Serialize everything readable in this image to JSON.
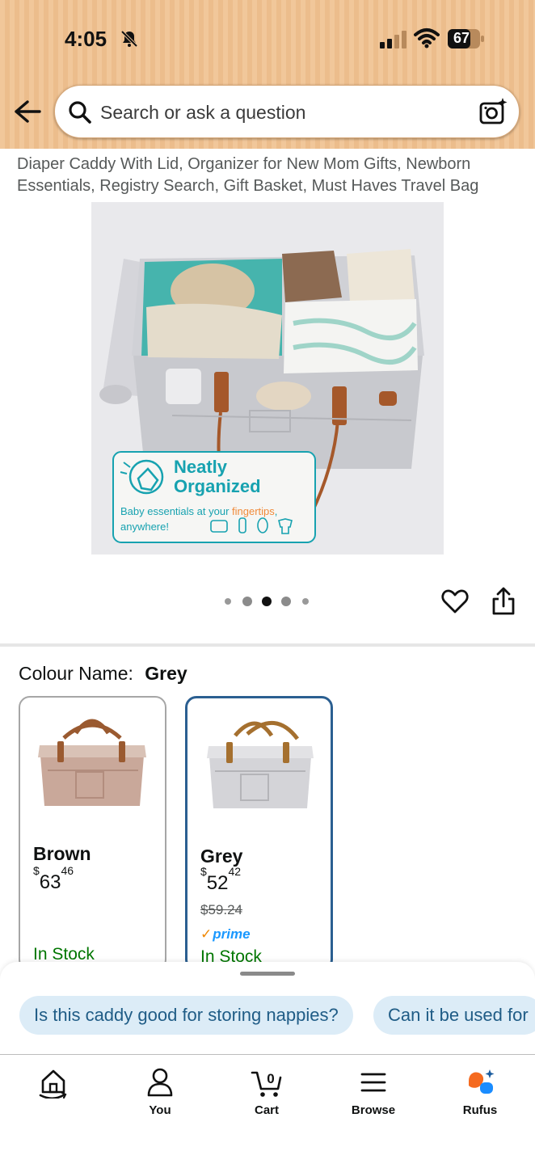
{
  "status": {
    "time": "4:05",
    "battery": "67"
  },
  "search": {
    "placeholder": "Search or ask a question"
  },
  "product": {
    "title": "Diaper Caddy With Lid, Organizer for New Mom Gifts, Newborn Essentials, Registry Search, Gift Basket, Must Haves Travel Bag",
    "image_overlay": {
      "headline_line1": "Neatly",
      "headline_line2": "Organized",
      "subtext_part1": "Baby essentials at your ",
      "subtext_highlight": "fingertips",
      "subtext_part2": ",",
      "subtext_line2": "anywhere!"
    },
    "carousel": {
      "count": 5,
      "active_index": 2
    }
  },
  "colour": {
    "label": "Colour Name:",
    "selected": "Grey",
    "options": [
      {
        "name": "Brown",
        "price_whole": "63",
        "price_fraction": "46",
        "currency": "$",
        "list_price": "",
        "prime": "",
        "stock": "In Stock"
      },
      {
        "name": "Grey",
        "price_whole": "52",
        "price_fraction": "42",
        "currency": "$",
        "list_price": "$59.24",
        "prime": "prime",
        "stock": "In Stock"
      }
    ]
  },
  "suggestions": [
    "Is this caddy good for storing nappies?",
    "Can it be used for"
  ],
  "nav": {
    "cart_count": "0",
    "items": [
      {
        "label": "",
        "icon": "home-icon"
      },
      {
        "label": "You",
        "icon": "person-icon"
      },
      {
        "label": "Cart",
        "icon": "cart-icon"
      },
      {
        "label": "Browse",
        "icon": "menu-icon"
      },
      {
        "label": "Rufus",
        "icon": "rufus-icon"
      }
    ]
  },
  "colors": {
    "header_bg": "#f1c79a",
    "in_stock": "#007600",
    "selected_border": "#2b5f91",
    "chip_bg": "#dcecf7",
    "chip_text": "#1f5c86",
    "prime_blue": "#1a98ff",
    "rufus_orange": "#f56a1f",
    "teal": "#17a2b0"
  }
}
